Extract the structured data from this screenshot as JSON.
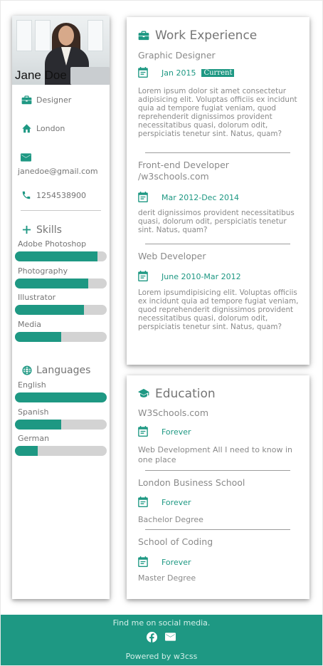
{
  "profile": {
    "name": "Jane Doe",
    "job": "Designer",
    "city": "London",
    "email": "janedoe@gmail.com",
    "phone": "1254538900"
  },
  "skills": {
    "title": "Skills",
    "items": [
      {
        "label": "Adobe Photoshop",
        "percent": 90
      },
      {
        "label": "Photography",
        "percent": 80
      },
      {
        "label": "Illustrator",
        "percent": 75
      },
      {
        "label": "Media",
        "percent": 50
      }
    ]
  },
  "languages": {
    "title": "Languages",
    "items": [
      {
        "label": "English",
        "percent": 100
      },
      {
        "label": "Spanish",
        "percent": 50
      },
      {
        "label": "German",
        "percent": 25
      }
    ]
  },
  "work": {
    "title": "Work Experience",
    "jobs": [
      {
        "title": "Graphic Designer",
        "date": "Jan 2015",
        "badge": "Current",
        "desc": "Lorem ipsum dolor sit amet consectetur adipisicing elit. Voluptas officiis ex incidunt quia ad tempore fugiat veniam, quod reprehenderit dignissimos provident necessitatibus quasi, dolorum odit, perspiciatis tenetur sint. Natus, quam?"
      },
      {
        "title": "Front-end Developer /w3schools.com",
        "date": "Mar 2012-Dec 2014",
        "badge": "",
        "desc": "derit dignissimos provident necessitatibus quasi, dolorum odit, perspiciatis tenetur sint. Natus, quam?"
      },
      {
        "title": "Web Developer",
        "date": "June 2010-Mar 2012",
        "badge": "",
        "desc": "Lorem ipsumdipisicing elit. Voluptas officiis ex incidunt quia ad tempore fugiat veniam, quod reprehenderit dignissimos provident necessitatibus quasi, dolorum odit, perspiciatis tenetur sint. Natus, quam?"
      }
    ]
  },
  "education": {
    "title": "Education",
    "schools": [
      {
        "title": "W3Schools.com",
        "date": "Forever",
        "desc": "Web Development All I need to know in one place"
      },
      {
        "title": "London Business School",
        "date": "Forever",
        "desc": "Bachelor Degree"
      },
      {
        "title": "School of Coding",
        "date": "Forever",
        "desc": "Master Degree"
      }
    ]
  },
  "footer": {
    "social_text": "Find me on social media.",
    "powered_prefix": "Powered by ",
    "powered_link": "w3css"
  },
  "icons": {
    "job": "briefcase-icon",
    "city": "home-icon",
    "email": "envelope-icon",
    "phone": "phone-icon",
    "skills": "plus-icon",
    "languages": "globe-icon",
    "work": "briefcase-icon",
    "date": "calendar-icon",
    "education": "graduation-cap-icon",
    "footer": [
      "facebook-icon",
      "envelope-icon"
    ]
  },
  "colors": {
    "accent": "#1e9883",
    "bar_track": "#d3d3d3",
    "text": "#757575"
  }
}
